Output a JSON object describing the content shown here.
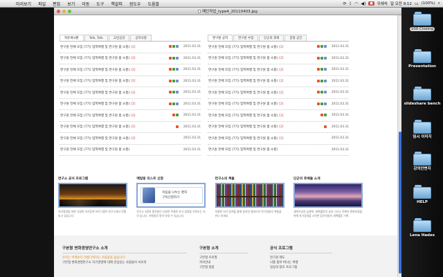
{
  "menubar": {
    "apple": "",
    "items": [
      "미리보기",
      "파일",
      "편집",
      "보기",
      "이동",
      "도구",
      "책갈피",
      "윈도우",
      "도움말"
    ],
    "status": {
      "user": "우헤숙",
      "clock": "일 오전 9:12",
      "battery": "(100%)"
    }
  },
  "window": {
    "title": "메인작업_type4_20110403.jpg"
  },
  "boards": {
    "left": {
      "tabs": [
        "자유게시판",
        "Talk, Talk",
        "고민공감",
        "공지사항"
      ],
      "posts": [
        {
          "title": "연구원 전체 모집 (7기) 입학여행 및 연구원 봄 소풍)",
          "comments": "[2]",
          "icons": [
            "new",
            "img",
            "file"
          ],
          "date": "2011.03.31"
        },
        {
          "title": "연구원 전체 모집 (7기) 입학여행 및 연구원 봄 소풍)",
          "comments": "[2]",
          "icons": [
            "new",
            "img",
            "file"
          ],
          "date": "2011.03.31"
        },
        {
          "title": "연구원 전체 모집 (7기) 입학여행 및 연구원 봄 소풍)",
          "comments": "[2]",
          "icons": [
            "new",
            "img",
            "file"
          ],
          "date": "2011.03.31"
        },
        {
          "title": "연구원 전체 모집 (7기) 입학여행 및 연구원 봄 소풍)",
          "comments": "[2]",
          "icons": [
            "new",
            "img",
            "file"
          ],
          "date": "2011.03.31"
        },
        {
          "title": "연구원 전체 모집 (7기) 입학여행 및 연구원 봄 소풍)",
          "comments": "[2]",
          "icons": [
            "new",
            "img",
            "file"
          ],
          "date": "2011.03.31"
        },
        {
          "title": "연구원 전체 모집 (7기) 입학여행 및 연구원 봄 소풍)",
          "comments": "[2]",
          "icons": [
            "new",
            "img",
            "file"
          ],
          "date": "2011.03.31"
        },
        {
          "title": "연구원 전체 모집 (7기) 입학여행 및 연구원 봄 소풍)",
          "comments": "[2]",
          "icons": [
            "new",
            "img"
          ],
          "date": "2011.03.31"
        },
        {
          "title": "연구원 전체 모집 (7기) 입학여행 및 연구원 봄 소풍)",
          "comments": "[2]",
          "icons": [
            "new"
          ],
          "date": "2011.03.31"
        },
        {
          "title": "연구원 전체 모집 (7기) 입학여행 및 연구원 봄 소풍)",
          "comments": "[2]",
          "icons": [],
          "date": "2011.03.31"
        },
        {
          "title": "연구원 전체 모집 (7기) 입학여행 및 연구원 봄 소풍)",
          "comments": "",
          "icons": [],
          "date": "2011.03.31"
        }
      ]
    },
    "right": {
      "tabs": [
        "연구원 공지",
        "연구원 수업",
        "단군의 후예",
        "꿈벗 공간"
      ],
      "posts": [
        {
          "title": "연구원 전체 모집 (7기) 입학여행 및 연구원 봄 소풍)",
          "comments": "[2]",
          "icons": [
            "new",
            "img",
            "file"
          ],
          "date": "2011.03.31"
        },
        {
          "title": "연구원 전체 모집 (7기) 입학여행 및 연구원 봄 소풍)",
          "comments": "[2]",
          "icons": [
            "new",
            "img",
            "file"
          ],
          "date": "2011.03.31"
        },
        {
          "title": "연구원 전체 모집 (7기) 입학여행 및 연구원 봄 소풍)",
          "comments": "[2]",
          "icons": [
            "new",
            "img",
            "file"
          ],
          "date": "2011.03.31"
        },
        {
          "title": "연구원 전체 모집 (7기) 입학여행 및 연구원 봄 소풍)",
          "comments": "[2]",
          "icons": [
            "new",
            "img",
            "file"
          ],
          "date": "2011.03.31"
        },
        {
          "title": "연구원 전체 모집 (7기) 입학여행 및 연구원 봄 소풍)",
          "comments": "[2]",
          "icons": [
            "new",
            "img",
            "file"
          ],
          "date": "2011.03.31"
        },
        {
          "title": "연구원 전체 모집 (7기) 입학여행 및 연구원 봄 소풍)",
          "comments": "[2]",
          "icons": [
            "new",
            "img",
            "file"
          ],
          "date": "2011.03.31"
        },
        {
          "title": "연구원 전체 모집 (7기) 입학여행 및 연구원 봄 소풍)",
          "comments": "[2]",
          "icons": [
            "new",
            "img"
          ],
          "date": "2011.03.31"
        },
        {
          "title": "연구원 전체 모집 (7기) 입학여행 및 연구원 봄 소풍)",
          "comments": "[2]",
          "icons": [
            "new"
          ],
          "date": "2011.03.31"
        },
        {
          "title": "연구원 전체 모집 (7기) 입학여행 및 연구원 봄 소풍)",
          "comments": "[2]",
          "icons": [],
          "date": "2011.03.31"
        },
        {
          "title": "연구원 전체 모집 (7기) 입학여행 및 연구원 봄 소풍)",
          "comments": "",
          "icons": [],
          "date": "2011.03.31"
        }
      ]
    }
  },
  "cards": [
    {
      "title": "연구소 공식 프로그램",
      "image": "sunset",
      "desc": "자아경영을 위한 다양한 자기탐색 프로그램이 연구소에서 진행되고 있습니다."
    },
    {
      "title": "메일링 리스트 신청",
      "image": "letter",
      "letter_line1": "마음을 나누는 편지",
      "letter_line2": "구독신청하기",
      "desc": "연구소 4명의 필진들이 다양한 주제로 자기 경영을 가꿔오는 자리 입니다. 이메일로 받아 보실 수 있습니다."
    },
    {
      "title": "연구소의 책들",
      "image": "books",
      "desc": "저명한 자기 탐색을 통해 정리된 결과으로 연구원들의 책들을 만나 보세요."
    },
    {
      "title": "단군의 후예들 소개",
      "image": "cloud",
      "desc": "새벽기상의 습관화, 새벽활동의 성과 그리고 전체의 변화과정을 위해 자기경영을 시작한 참가자들의 새벽활동 기록."
    }
  ],
  "footer": {
    "col1": {
      "heading": "구본형 변화경영연구소 소개",
      "sub": "우리는 어제보다 아름다워지는 사람들을 돕습니다.",
      "line": "구본형 변화경영연구소 자기경영에 대해 관심있는 사람들이 서로의"
    },
    "col2": {
      "heading": "구본형 소개",
      "lines": [
        "구본형 프로필",
        "저서안내",
        "구본형 칼럼"
      ]
    },
    "col3": {
      "heading": "공식 프로그램",
      "lines": [
        "연구원 제도",
        "나를 찾아 떠나는 여행",
        "일상의 창조 프로그램"
      ]
    }
  },
  "desktop": {
    "items": [
      {
        "label": "100 Closing",
        "style": "pill"
      },
      {
        "label": "Presentation",
        "style": "plain"
      },
      {
        "label": "slideshare bench",
        "style": "plain"
      },
      {
        "label": "임시 이미지",
        "style": "plain"
      },
      {
        "label": "강의안변지",
        "style": "plain"
      },
      {
        "label": "HELP",
        "style": "plain"
      },
      {
        "label": "Lena Hades",
        "style": "plain"
      }
    ]
  }
}
